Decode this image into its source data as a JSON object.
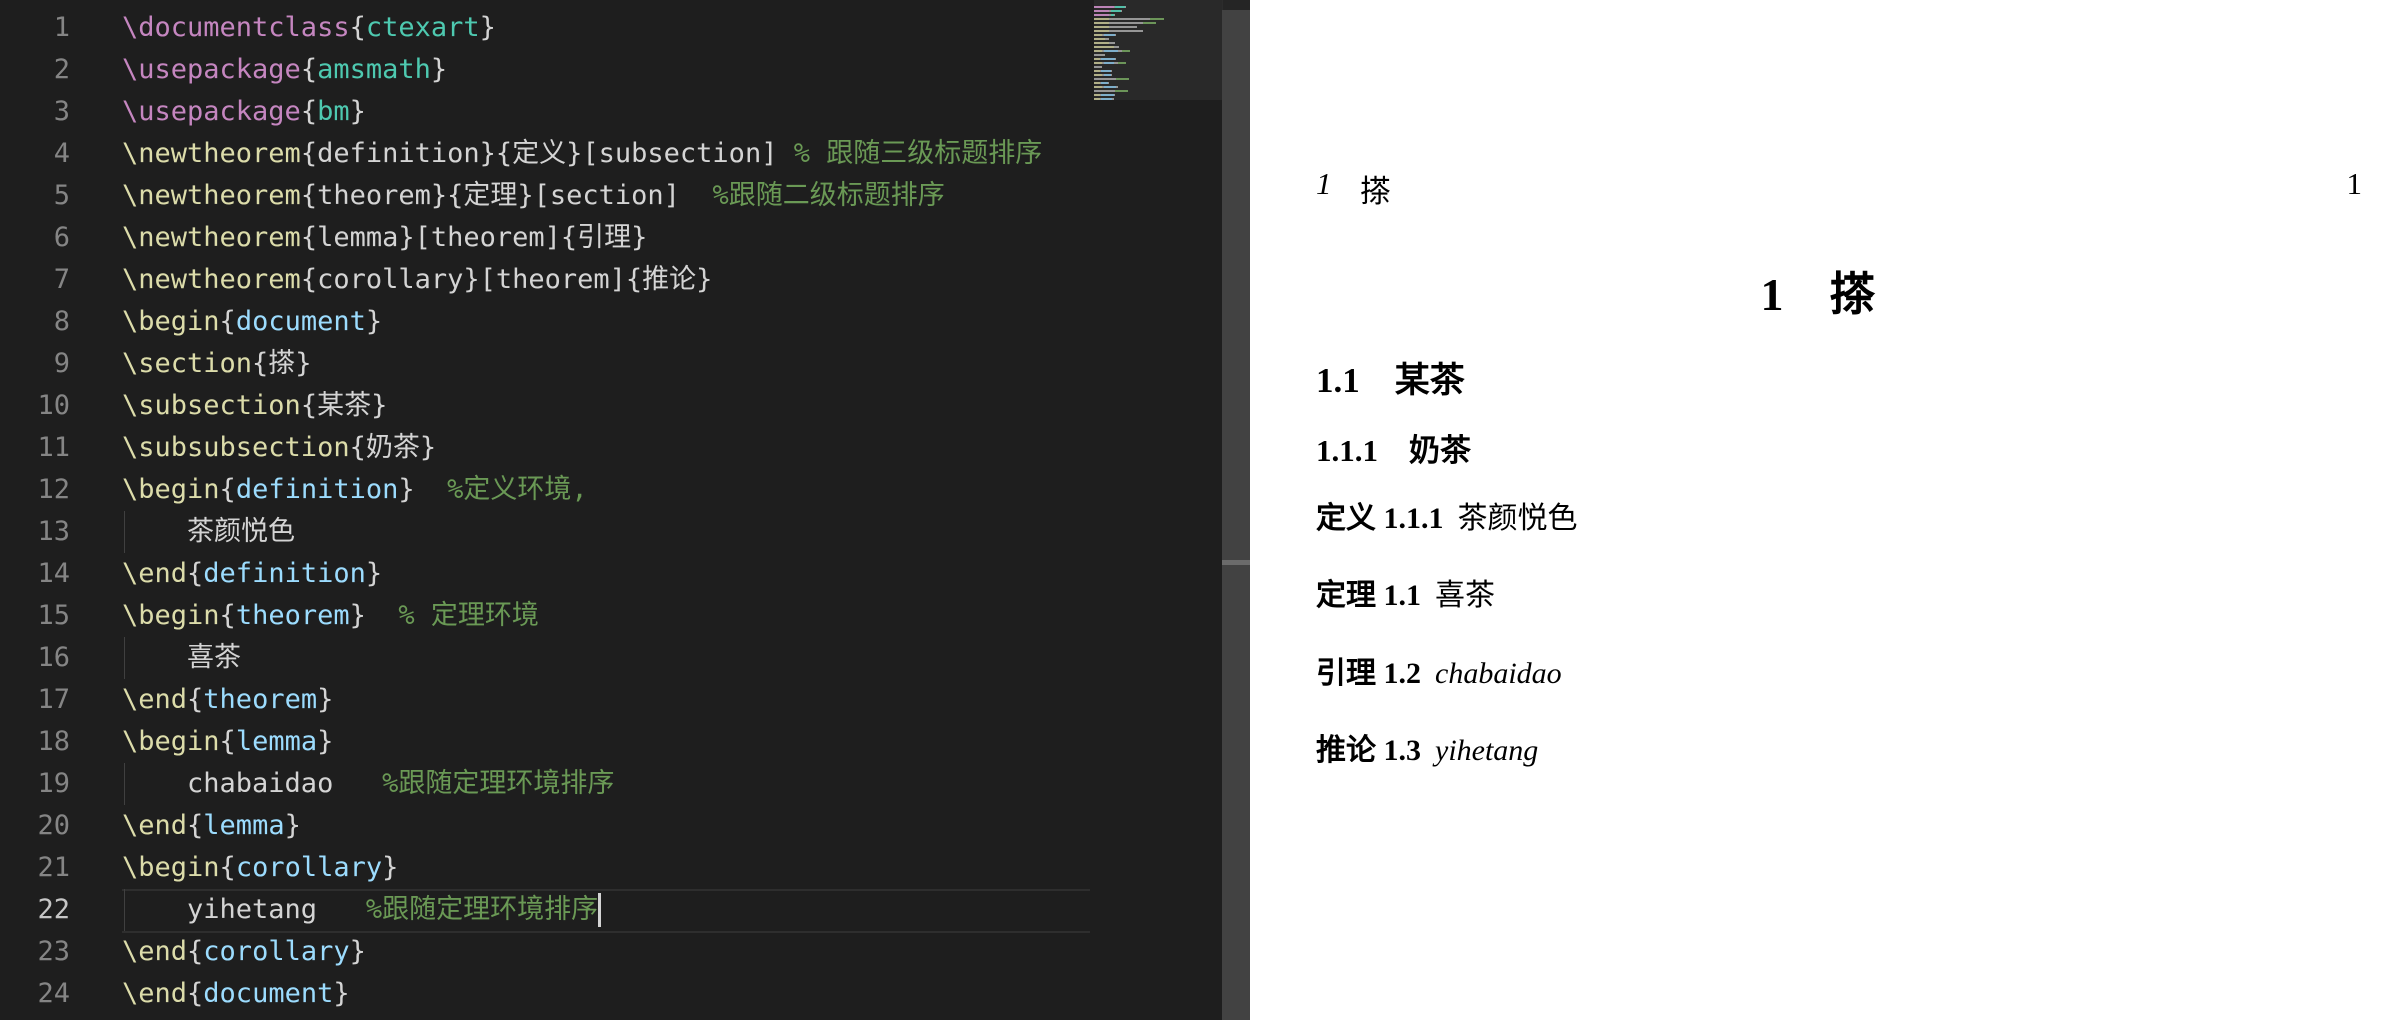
{
  "editor": {
    "line_numbers": [
      "1",
      "2",
      "3",
      "4",
      "5",
      "6",
      "7",
      "8",
      "9",
      "10",
      "11",
      "12",
      "13",
      "14",
      "15",
      "16",
      "17",
      "18",
      "19",
      "20",
      "21",
      "22",
      "23",
      "24"
    ],
    "active_line": "22",
    "lines": [
      {
        "tokens": [
          {
            "t": "\\documentclass",
            "c": "cmd"
          },
          {
            "t": "{",
            "c": "br"
          },
          {
            "t": "ctexart",
            "c": "pkg"
          },
          {
            "t": "}",
            "c": "br"
          }
        ]
      },
      {
        "tokens": [
          {
            "t": "\\usepackage",
            "c": "cmd"
          },
          {
            "t": "{",
            "c": "br"
          },
          {
            "t": "amsmath",
            "c": "pkg"
          },
          {
            "t": "}",
            "c": "br"
          }
        ]
      },
      {
        "tokens": [
          {
            "t": "\\usepackage",
            "c": "cmd"
          },
          {
            "t": "{",
            "c": "br"
          },
          {
            "t": "bm",
            "c": "pkg"
          },
          {
            "t": "}",
            "c": "br"
          }
        ]
      },
      {
        "tokens": [
          {
            "t": "\\newtheorem",
            "c": "kw"
          },
          {
            "t": "{definition}{定义}[subsection] ",
            "c": "arg"
          },
          {
            "t": "% 跟随三级标题排序",
            "c": "com"
          }
        ]
      },
      {
        "tokens": [
          {
            "t": "\\newtheorem",
            "c": "kw"
          },
          {
            "t": "{theorem}{定理}[section]  ",
            "c": "arg"
          },
          {
            "t": "%跟随二级标题排序",
            "c": "com"
          }
        ]
      },
      {
        "tokens": [
          {
            "t": "\\newtheorem",
            "c": "kw"
          },
          {
            "t": "{lemma}[theorem]{引理}",
            "c": "arg"
          }
        ]
      },
      {
        "tokens": [
          {
            "t": "\\newtheorem",
            "c": "kw"
          },
          {
            "t": "{corollary}[theorem]{推论}",
            "c": "arg"
          }
        ]
      },
      {
        "tokens": [
          {
            "t": "\\begin",
            "c": "kw"
          },
          {
            "t": "{",
            "c": "br"
          },
          {
            "t": "document",
            "c": "env"
          },
          {
            "t": "}",
            "c": "br"
          }
        ]
      },
      {
        "tokens": [
          {
            "t": "\\section",
            "c": "kw"
          },
          {
            "t": "{搽}",
            "c": "arg"
          }
        ]
      },
      {
        "tokens": [
          {
            "t": "\\subsection",
            "c": "kw"
          },
          {
            "t": "{某茶}",
            "c": "arg"
          }
        ]
      },
      {
        "tokens": [
          {
            "t": "\\subsubsection",
            "c": "kw"
          },
          {
            "t": "{奶茶}",
            "c": "arg"
          }
        ]
      },
      {
        "tokens": [
          {
            "t": "\\begin",
            "c": "kw"
          },
          {
            "t": "{",
            "c": "br"
          },
          {
            "t": "definition",
            "c": "env"
          },
          {
            "t": "}  ",
            "c": "br"
          },
          {
            "t": "%定义环境,",
            "c": "com"
          }
        ]
      },
      {
        "tokens": [
          {
            "t": "    茶颜悦色",
            "c": "arg"
          }
        ]
      },
      {
        "tokens": [
          {
            "t": "\\end",
            "c": "kw"
          },
          {
            "t": "{",
            "c": "br"
          },
          {
            "t": "definition",
            "c": "env"
          },
          {
            "t": "}",
            "c": "br"
          }
        ]
      },
      {
        "tokens": [
          {
            "t": "\\begin",
            "c": "kw"
          },
          {
            "t": "{",
            "c": "br"
          },
          {
            "t": "theorem",
            "c": "env"
          },
          {
            "t": "}  ",
            "c": "br"
          },
          {
            "t": "% 定理环境",
            "c": "com"
          }
        ]
      },
      {
        "tokens": [
          {
            "t": "    喜茶",
            "c": "arg"
          }
        ]
      },
      {
        "tokens": [
          {
            "t": "\\end",
            "c": "kw"
          },
          {
            "t": "{",
            "c": "br"
          },
          {
            "t": "theorem",
            "c": "env"
          },
          {
            "t": "}",
            "c": "br"
          }
        ]
      },
      {
        "tokens": [
          {
            "t": "\\begin",
            "c": "kw"
          },
          {
            "t": "{",
            "c": "br"
          },
          {
            "t": "lemma",
            "c": "env"
          },
          {
            "t": "}",
            "c": "br"
          }
        ]
      },
      {
        "tokens": [
          {
            "t": "    chabaidao   ",
            "c": "arg"
          },
          {
            "t": "%跟随定理环境排序",
            "c": "com"
          }
        ]
      },
      {
        "tokens": [
          {
            "t": "\\end",
            "c": "kw"
          },
          {
            "t": "{",
            "c": "br"
          },
          {
            "t": "lemma",
            "c": "env"
          },
          {
            "t": "}",
            "c": "br"
          }
        ]
      },
      {
        "tokens": [
          {
            "t": "\\begin",
            "c": "kw"
          },
          {
            "t": "{",
            "c": "br"
          },
          {
            "t": "corollary",
            "c": "env"
          },
          {
            "t": "}",
            "c": "br"
          }
        ]
      },
      {
        "tokens": [
          {
            "t": "    yihetang   ",
            "c": "arg"
          },
          {
            "t": "%跟随定理环境排序",
            "c": "com"
          }
        ]
      },
      {
        "tokens": [
          {
            "t": "\\end",
            "c": "kw"
          },
          {
            "t": "{",
            "c": "br"
          },
          {
            "t": "corollary",
            "c": "env"
          },
          {
            "t": "}",
            "c": "br"
          }
        ]
      },
      {
        "tokens": [
          {
            "t": "\\end",
            "c": "kw"
          },
          {
            "t": "{",
            "c": "br"
          },
          {
            "t": "document",
            "c": "env"
          },
          {
            "t": "}",
            "c": "br"
          }
        ]
      }
    ],
    "colors": {
      "background": "#1e1e1e",
      "command": "#c586c0",
      "keyword": "#dcdcaa",
      "package": "#4ec9b0",
      "environment": "#9cdcfe",
      "comment": "#6a9955",
      "text": "#d4d4d4"
    }
  },
  "preview": {
    "running_header_num": "1",
    "running_header_title": "搽",
    "page_number": "1",
    "section": "1　搽",
    "subsection": "1.1　某茶",
    "subsubsection": "1.1.1　奶茶",
    "theorems": {
      "definition": {
        "label": "定义 1.1.1",
        "body": "茶颜悦色"
      },
      "theorem": {
        "label": "定理 1.1",
        "body": "喜茶"
      },
      "lemma": {
        "label": "引理 1.2",
        "body": "chabaidao"
      },
      "corollary": {
        "label": "推论 1.3",
        "body": "yihetang"
      }
    }
  }
}
